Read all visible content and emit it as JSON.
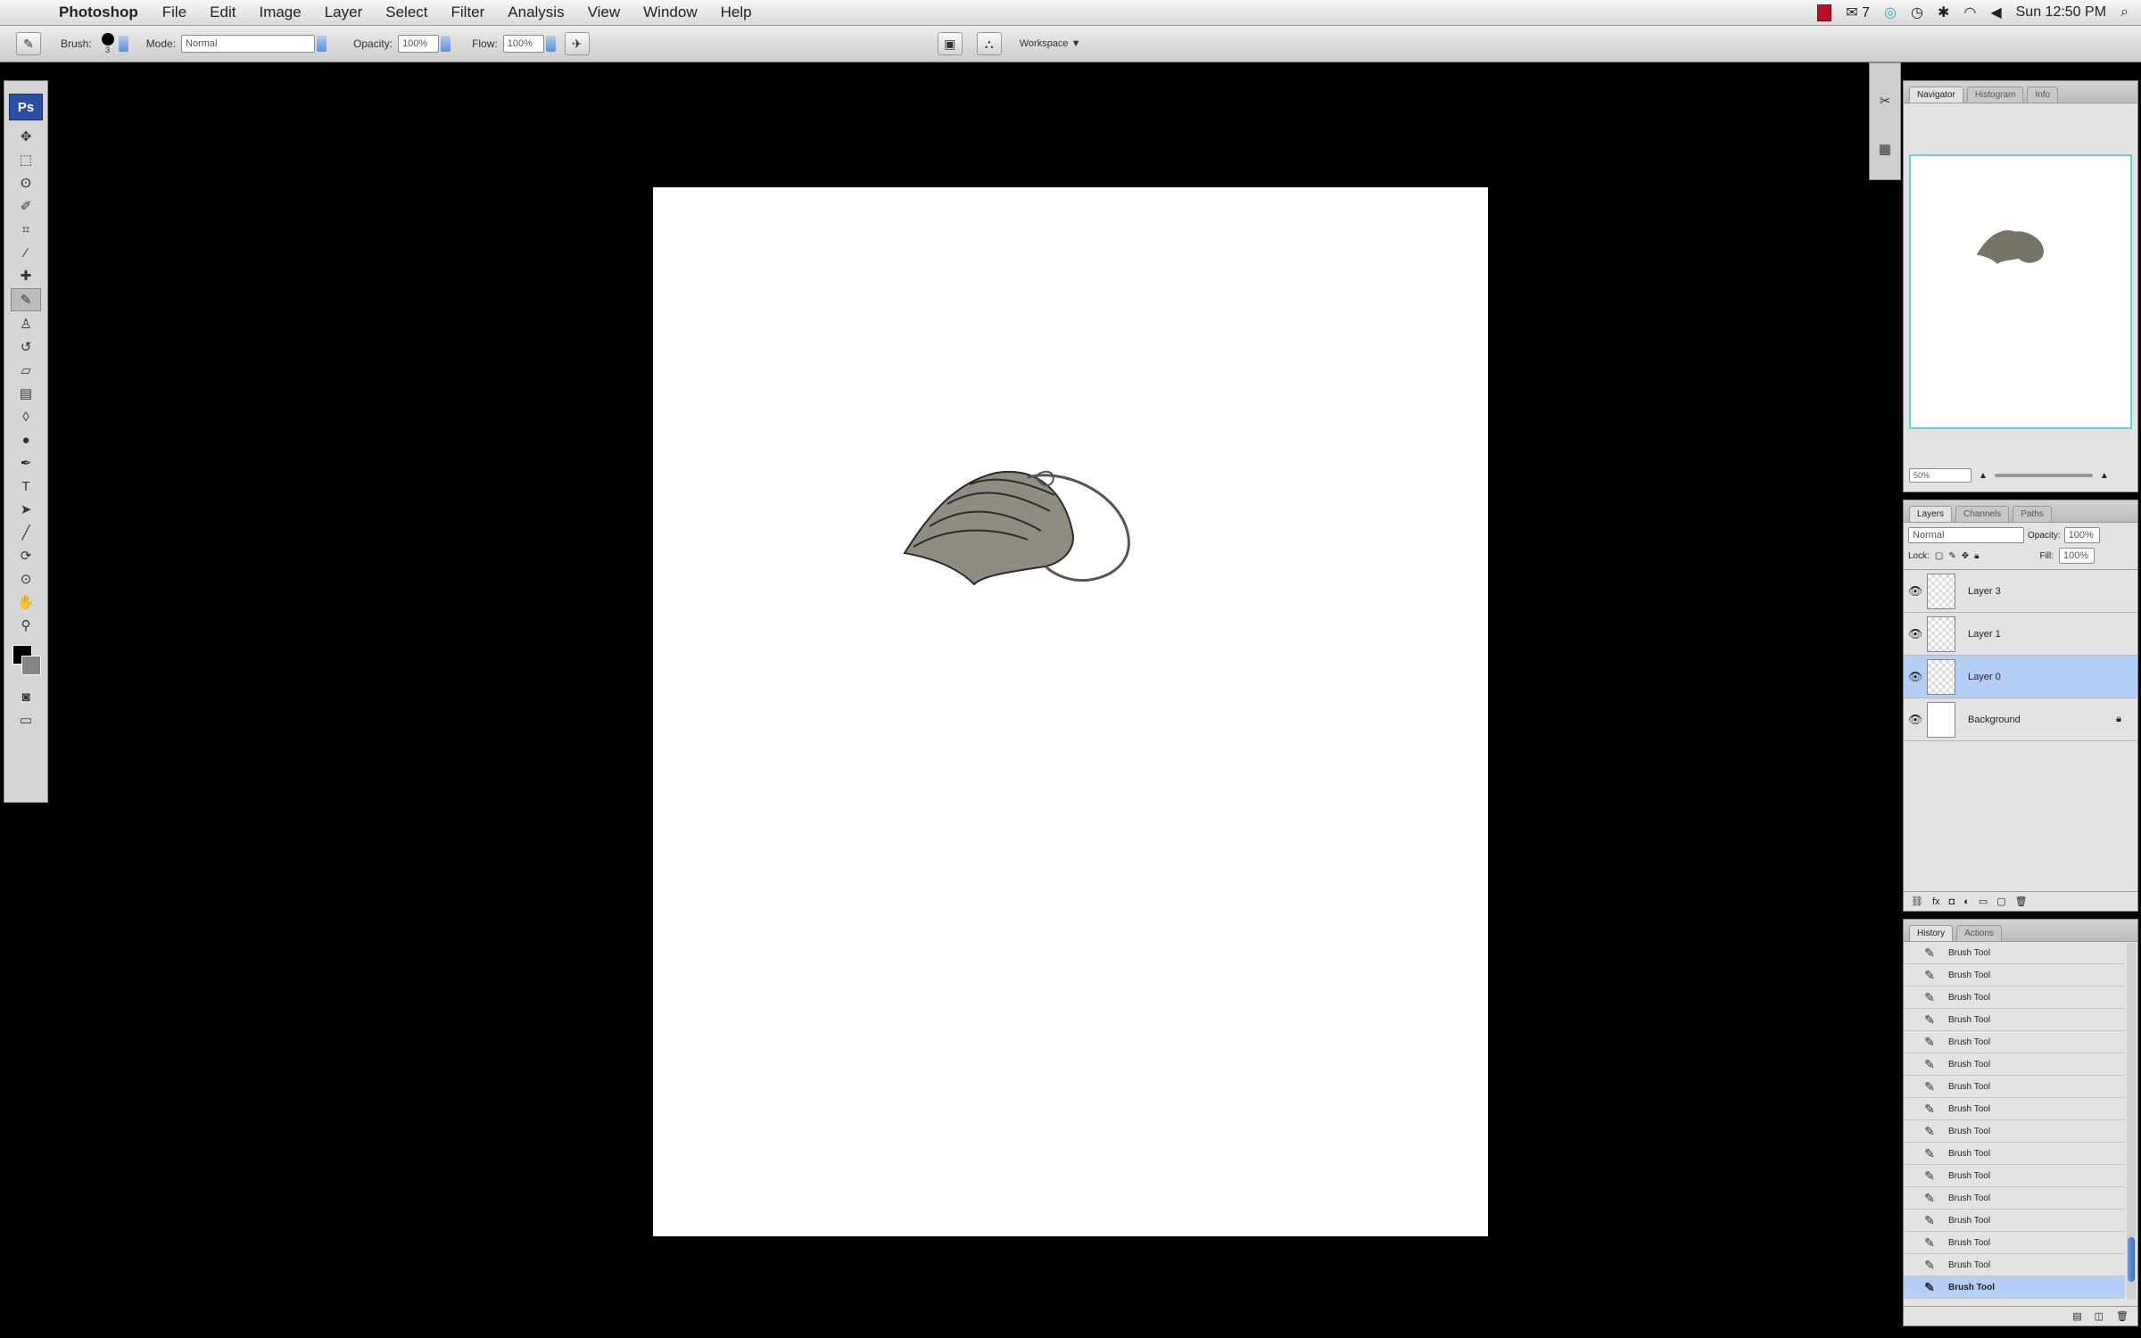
{
  "menubar": {
    "app_name": "Photoshop",
    "items": [
      "File",
      "Edit",
      "Image",
      "Layer",
      "Select",
      "Filter",
      "Analysis",
      "View",
      "Window",
      "Help"
    ],
    "status": {
      "mail_count": "7",
      "clock": "Sun 12:50 PM"
    }
  },
  "options_bar": {
    "brush_label": "Brush:",
    "brush_size": "3",
    "mode_label": "Mode:",
    "mode_value": "Normal",
    "opacity_label": "Opacity:",
    "opacity_value": "100%",
    "flow_label": "Flow:",
    "flow_value": "100%",
    "workspace_label": "Workspace ▼"
  },
  "tools": {
    "logo": "Ps",
    "icons": [
      "move-icon",
      "marquee-icon",
      "lasso-icon",
      "quick-select-icon",
      "crop-icon",
      "eyedropper-icon",
      "healing-icon",
      "brush-icon",
      "clone-stamp-icon",
      "history-brush-icon",
      "eraser-icon",
      "gradient-icon",
      "blur-icon",
      "dodge-icon",
      "pen-icon",
      "type-icon",
      "path-select-icon",
      "shape-icon",
      "3d-rotate-icon",
      "3d-orbit-icon",
      "hand-icon",
      "zoom-icon"
    ],
    "foreground_color": "#000000",
    "background_color": "#858585"
  },
  "navigator": {
    "tabs": [
      "Navigator",
      "Histogram",
      "Info"
    ],
    "zoom_value": "50%"
  },
  "layers": {
    "tabs": [
      "Layers",
      "Channels",
      "Paths"
    ],
    "blend_mode": "Normal",
    "opacity_label": "Opacity:",
    "opacity_value": "100%",
    "lock_label": "Lock:",
    "fill_label": "Fill:",
    "fill_value": "100%",
    "rows": [
      {
        "name": "Layer 3",
        "selected": false
      },
      {
        "name": "Layer 1",
        "selected": false
      },
      {
        "name": "Layer 0",
        "selected": true
      },
      {
        "name": "Background",
        "selected": false
      }
    ]
  },
  "history": {
    "tabs": [
      "History",
      "Actions"
    ],
    "rows": [
      "Brush Tool",
      "Brush Tool",
      "Brush Tool",
      "Brush Tool",
      "Brush Tool",
      "Brush Tool",
      "Brush Tool",
      "Brush Tool",
      "Brush Tool",
      "Brush Tool",
      "Brush Tool",
      "Brush Tool",
      "Brush Tool",
      "Brush Tool",
      "Brush Tool",
      "Brush Tool"
    ],
    "selected_index": 15
  },
  "colors": {
    "selection_blue": "#b4cff6",
    "navigator_frame": "#5fd5d5",
    "shape_fill": "#8f8d81"
  }
}
